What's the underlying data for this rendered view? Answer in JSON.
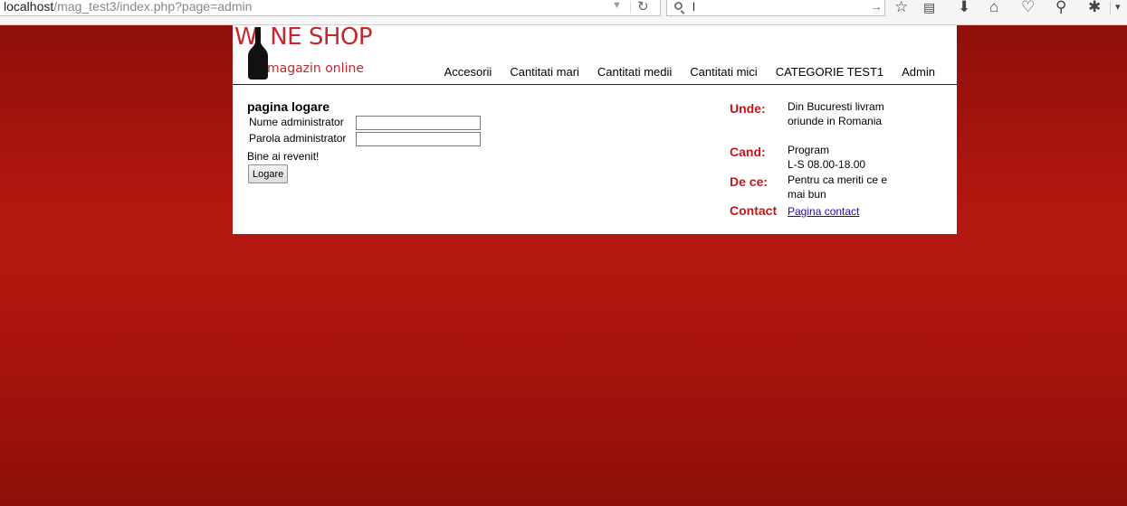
{
  "browser": {
    "url_host": "localhost",
    "url_path": "/mag_test3/index.php?page=admin",
    "search_value": "l"
  },
  "logo": {
    "title_part1": "W",
    "title_part2": "NE SHOP",
    "subtitle": "magazin online"
  },
  "nav": {
    "items": [
      "Accesorii",
      "Cantitati mari",
      "Cantitati medii",
      "Cantitati mici",
      "CATEGORIE TEST1",
      "Admin"
    ]
  },
  "login": {
    "title": "pagina logare",
    "username_label": "Nume administrator",
    "username_value": "",
    "password_label": "Parola administrator",
    "password_value": "",
    "welcome": "Bine ai revenit!",
    "button": "Logare"
  },
  "info": {
    "unde_label": "Unde:",
    "unde_value": "Din Bucuresti livram oriunde in Romania",
    "cand_label": "Cand:",
    "cand_line1": "Program",
    "cand_line2": "L-S 08.00-18.00",
    "dece_label": "De ce:",
    "dece_value": "Pentru ca meriti ce e mai bun",
    "contact_label": "Contact",
    "contact_link": "Pagina contact"
  },
  "colors": {
    "brand": "#c4282f",
    "label_red": "#c4151b",
    "background": "#b3170f"
  }
}
